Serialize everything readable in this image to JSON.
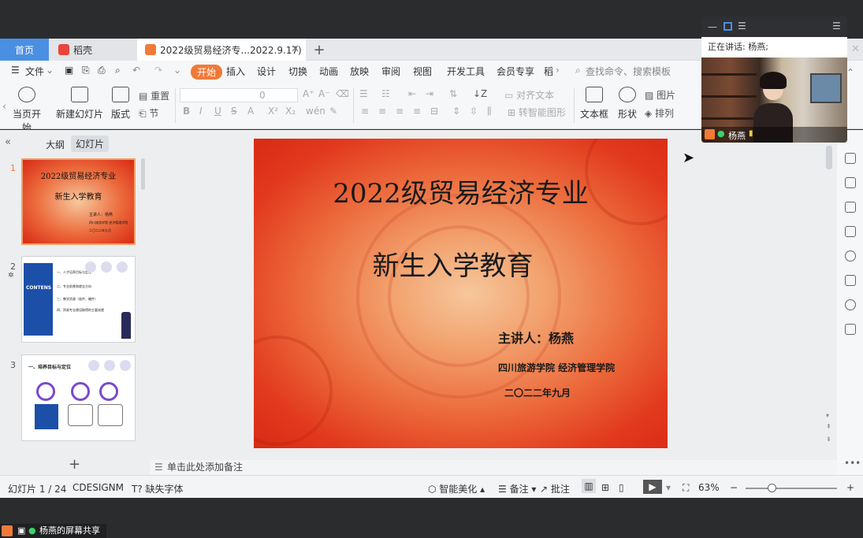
{
  "tabs": {
    "home": "首页",
    "daoke": "稻壳",
    "doc": "2022级贸易经济专...2022.9.17)",
    "close": "✕",
    "plus": "+"
  },
  "menu": {
    "file": "文件",
    "items": [
      "开始",
      "插入",
      "设计",
      "切换",
      "动画",
      "放映",
      "审阅",
      "视图",
      "开发工具",
      "会员专享",
      "稻"
    ],
    "search_placeholder": "查找命令、搜索模板"
  },
  "toolbar": {
    "from_current": "当页开始",
    "new_slide": "新建幻灯片",
    "layout": "版式",
    "reset": "重置",
    "section": "节",
    "font_size": "0",
    "align_text": "对齐文本",
    "convert_smartart": "转智能图形",
    "textbox": "文本框",
    "shape": "形状",
    "picture": "图片",
    "arrange": "排列"
  },
  "left_panel": {
    "tab_outline": "大纲",
    "tab_slides": "幻灯片",
    "add": "+",
    "thumbs": [
      {
        "num": "1",
        "title": "2022级贸易经济专业",
        "subtitle": "新生入学教育",
        "speaker": "主讲人：杨燕",
        "org": "四川旅游学院 经济管理学院",
        "date": "二〇二二年九月"
      },
      {
        "num": "2",
        "side": "CONTENS",
        "items": [
          "一、人才培养目标与定位",
          "二、专业前景和就业方向",
          "三、教学资源（软件、硬件）",
          "四、贸易专业建设取得的主要成就"
        ]
      },
      {
        "num": "3",
        "title": "一、培养目标与定位"
      }
    ]
  },
  "slide": {
    "title": "2022级贸易经济专业",
    "subtitle": "新生入学教育",
    "speaker": "主讲人：杨燕",
    "org": "四川旅游学院  经济管理学院",
    "date": "二〇二二年九月"
  },
  "notes": {
    "placeholder": "单击此处添加备注"
  },
  "status": {
    "slide_count": "幻灯片 1 / 24",
    "theme": "CDESIGNM",
    "missing_font": "缺失字体",
    "beautify": "智能美化",
    "notes": "备注",
    "comments": "批注",
    "zoom": "63%"
  },
  "video": {
    "speaking": "正在讲话: 杨燕;",
    "name": "杨燕"
  },
  "share": {
    "label": "杨燕的屏幕共享"
  },
  "colors": {
    "accent": "#f17a37",
    "home_tab": "#4a90e2",
    "slide_red": "#e23a1e"
  }
}
